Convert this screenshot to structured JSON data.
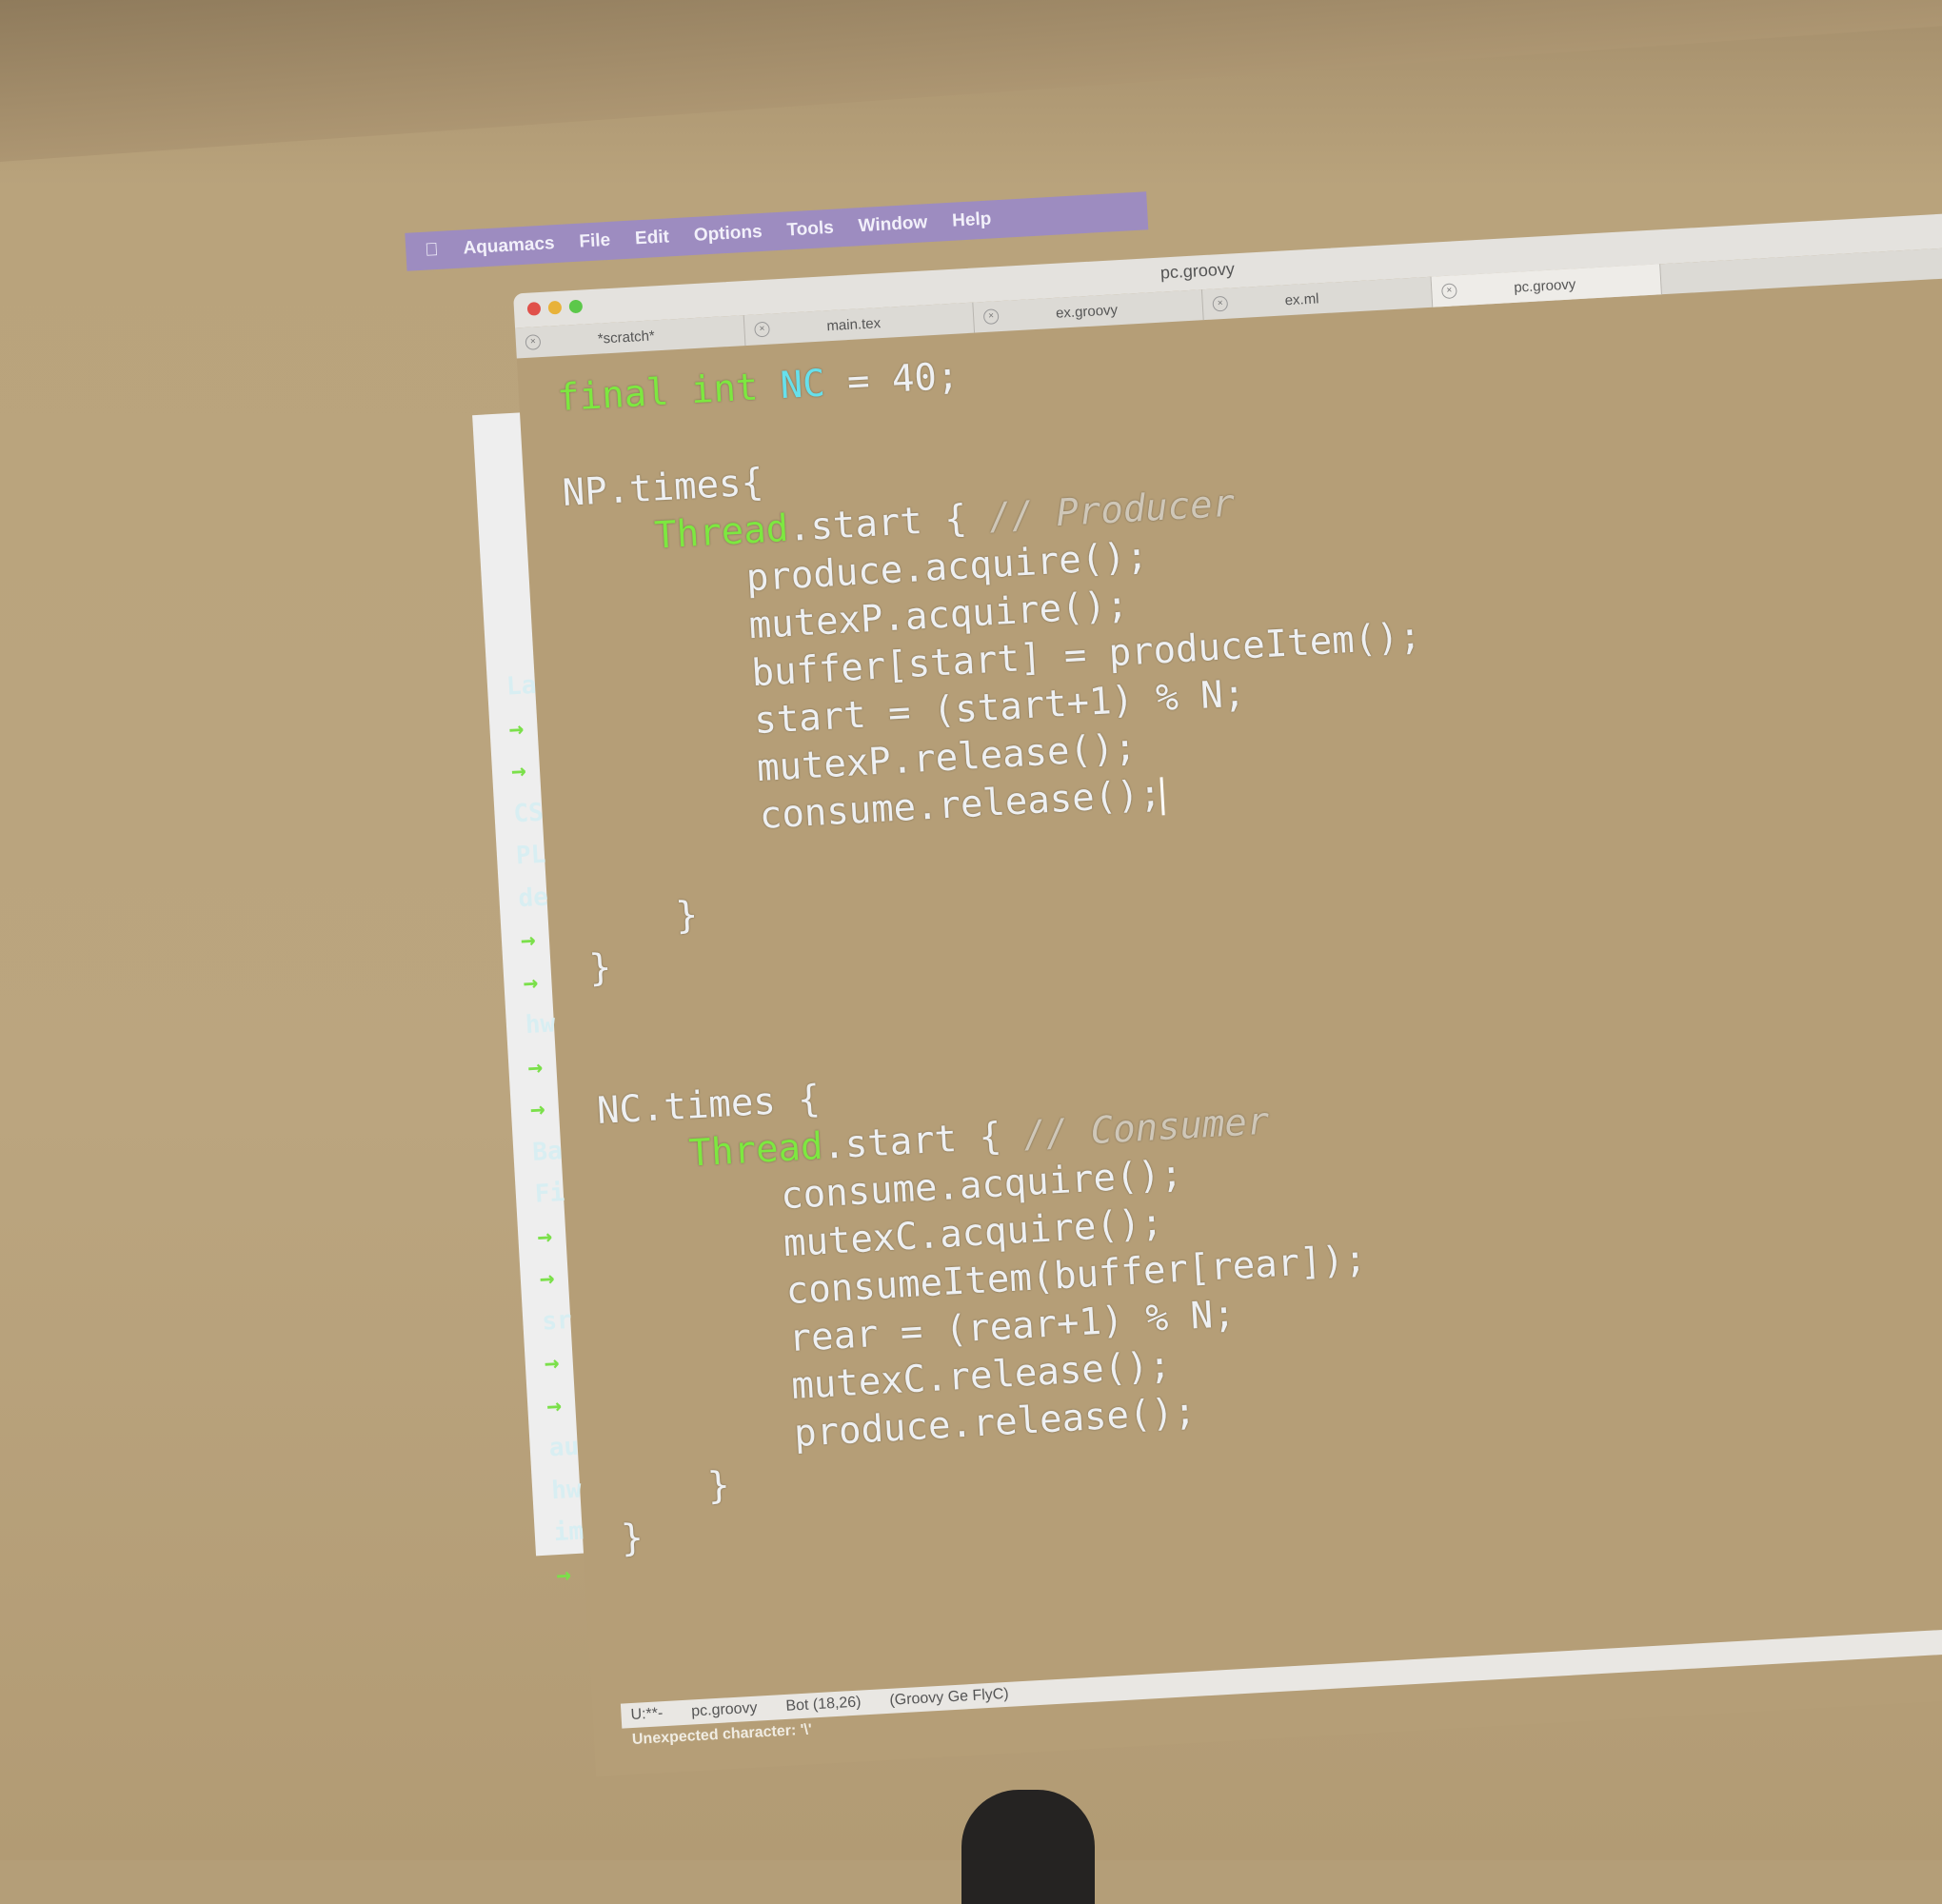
{
  "menubar": {
    "apple_icon": "apple-icon",
    "items": [
      "Aquamacs",
      "File",
      "Edit",
      "Options",
      "Tools",
      "Window",
      "Help"
    ]
  },
  "window": {
    "title": "pc.groovy",
    "tabs": [
      {
        "label": "*scratch*"
      },
      {
        "label": "main.tex"
      },
      {
        "label": "ex.groovy"
      },
      {
        "label": "ex.ml"
      },
      {
        "label": "pc.groovy",
        "active": true
      }
    ]
  },
  "gutter": [
    "La",
    "→",
    "→",
    "CS",
    "PL",
    "de",
    "→",
    "→",
    "hw",
    "→",
    "→",
    "Ba",
    "Fi",
    "→",
    "→",
    "sr",
    "→",
    "→",
    "au",
    "hw",
    "im",
    "→"
  ],
  "code": {
    "l1": {
      "a": "final",
      "b": "int",
      "c": "NC",
      "d": " = 40;"
    },
    "l3": "NP.times{",
    "l4": {
      "a": "Thread",
      ".b": "",
      "b": ".start { ",
      "c": "// Producer"
    },
    "producer": [
      "produce.acquire();",
      "mutexP.acquire();",
      "buffer[start] = produceItem();",
      "start = (start+1) % N;",
      "mutexP.release();",
      "consume.release();"
    ],
    "close_inner": "}",
    "close_outer": "}",
    "l15": "NC.times {",
    "l16": {
      "a": "Thread",
      "b": ".start { ",
      "c": "// Consumer"
    },
    "consumer": [
      "consume.acquire();",
      "mutexC.acquire();",
      "consumeItem(buffer[rear]);",
      "rear = (rear+1) % N;",
      "mutexC.release();",
      "produce.release();"
    ]
  },
  "modeline": {
    "state": "U:**-",
    "buffer": "pc.groovy",
    "position": "Bot (18,26)",
    "mode": "(Groovy Ge FlyC)"
  },
  "echo": "Unexpected character: '\\'"
}
